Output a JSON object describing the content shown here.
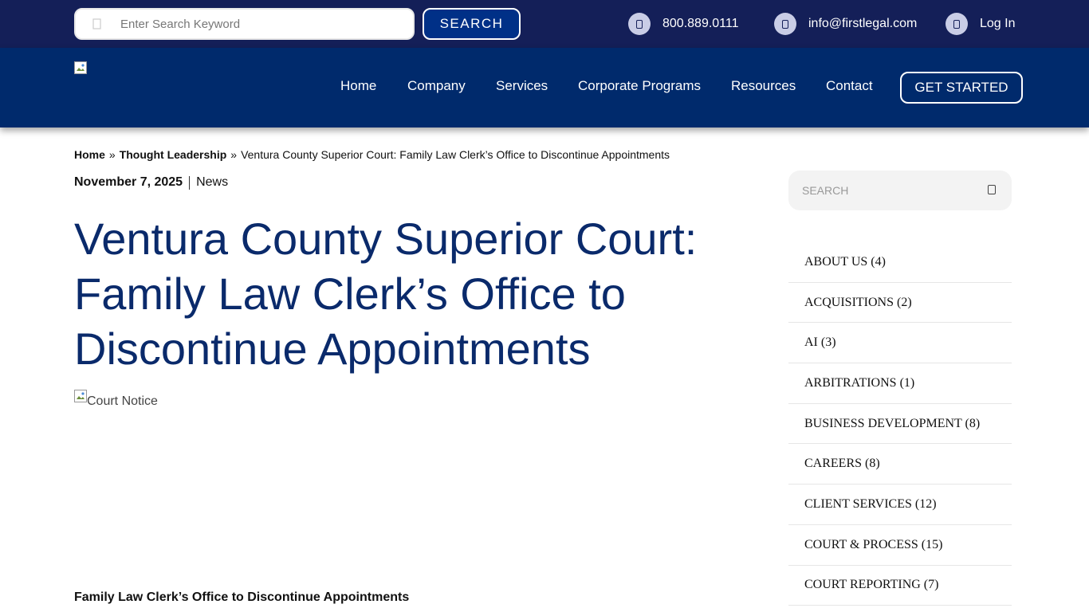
{
  "topbar": {
    "search_placeholder": "Enter Search Keyword",
    "search_button": "SEARCH",
    "phone": "800.889.0111",
    "email": "info@firstlegal.com",
    "login": "Log In"
  },
  "nav": {
    "items": [
      "Home",
      "Company",
      "Services",
      "Corporate Programs",
      "Resources",
      "Contact"
    ],
    "cta": "GET STARTED"
  },
  "breadcrumb": {
    "home": "Home",
    "separator": "»",
    "section": "Thought Leadership",
    "current": "Ventura County Superior Court: Family Law Clerk’s Office to Discontinue Appointments"
  },
  "post": {
    "date": "November 7, 2025",
    "category": "News",
    "title": "Ventura County Superior Court: Family Law Clerk’s Office to Discontinue Appointments",
    "image_alt": "Court Notice",
    "subheading": "Family Law Clerk’s Office to Discontinue Appointments"
  },
  "sidebar": {
    "search_placeholder": "SEARCH",
    "categories": [
      "ABOUT US (4)",
      "ACQUISITIONS (2)",
      "AI (3)",
      "ARBITRATIONS (1)",
      "BUSINESS DEVELOPMENT (8)",
      "CAREERS (8)",
      "CLIENT SERVICES (12)",
      "COURT & PROCESS (15)",
      "COURT REPORTING (7)"
    ]
  },
  "colors": {
    "topbar_bg": "#141f58",
    "nav_bg": "#002a6c",
    "title": "#0a2a6b"
  }
}
